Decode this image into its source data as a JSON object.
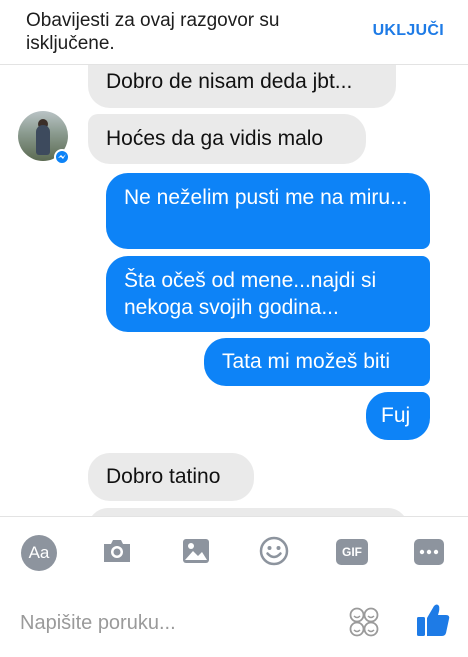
{
  "banner": {
    "message": "Obavijesti za ovaj razgovor su isključene.",
    "action_label": "UKLJUČI"
  },
  "messages": [
    {
      "from": "them",
      "text": "Dobro de nisam deda jbt..."
    },
    {
      "from": "them",
      "text": "Hoćes da ga vidis malo"
    },
    {
      "from": "me",
      "text": "Ne neželim pusti me na miru..."
    },
    {
      "from": "me",
      "text": "Šta očeš od mene...najdi si nekoga svojih godina..."
    },
    {
      "from": "me",
      "text": "Tata mi možeš biti"
    },
    {
      "from": "me",
      "text": "Fuj"
    },
    {
      "from": "them",
      "text": "Dobro tatino"
    }
  ],
  "toolbar": {
    "items": [
      "text-format-icon",
      "camera-icon",
      "image-icon",
      "emoji-icon",
      "gif-icon",
      "more-icon"
    ],
    "text_format_label": "Aa",
    "gif_label": "GIF"
  },
  "composer": {
    "placeholder": "Napišite poruku..."
  },
  "colors": {
    "accent": "#1e7be6",
    "outgoing_bubble": "#0d83f7",
    "incoming_bubble": "#eaeaea"
  }
}
